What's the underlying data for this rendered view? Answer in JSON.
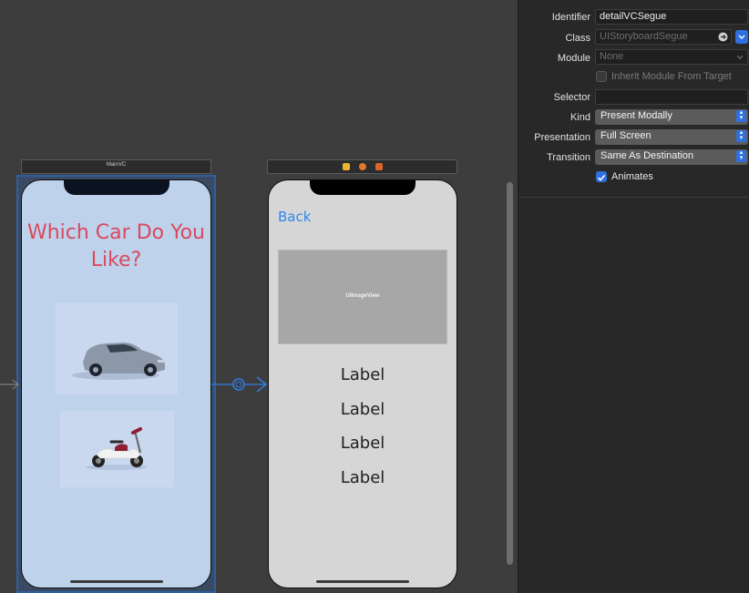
{
  "canvas": {
    "scene_main": {
      "title": "MainVC",
      "heading": "Which Car Do You Like?"
    },
    "scene_detail": {
      "back_label": "Back",
      "image_view_label": "UIImageView",
      "labels": [
        "Label",
        "Label",
        "Label",
        "Label"
      ]
    }
  },
  "inspector": {
    "identifier": {
      "label": "Identifier",
      "value": "detailVCSegue"
    },
    "class": {
      "label": "Class",
      "value": "UIStoryboardSegue"
    },
    "module": {
      "label": "Module",
      "value": "None"
    },
    "inherit": {
      "label": "Inherit Module From Target",
      "checked": false
    },
    "selector": {
      "label": "Selector",
      "value": ""
    },
    "kind": {
      "label": "Kind",
      "value": "Present Modally"
    },
    "presentation": {
      "label": "Presentation",
      "value": "Full Screen"
    },
    "transition": {
      "label": "Transition",
      "value": "Same As Destination"
    },
    "animates": {
      "label": "Animates",
      "checked": true
    }
  },
  "colors": {
    "accent": "#2f6fde",
    "title_red": "#d9495e",
    "segue_blue": "#2e7de6"
  }
}
